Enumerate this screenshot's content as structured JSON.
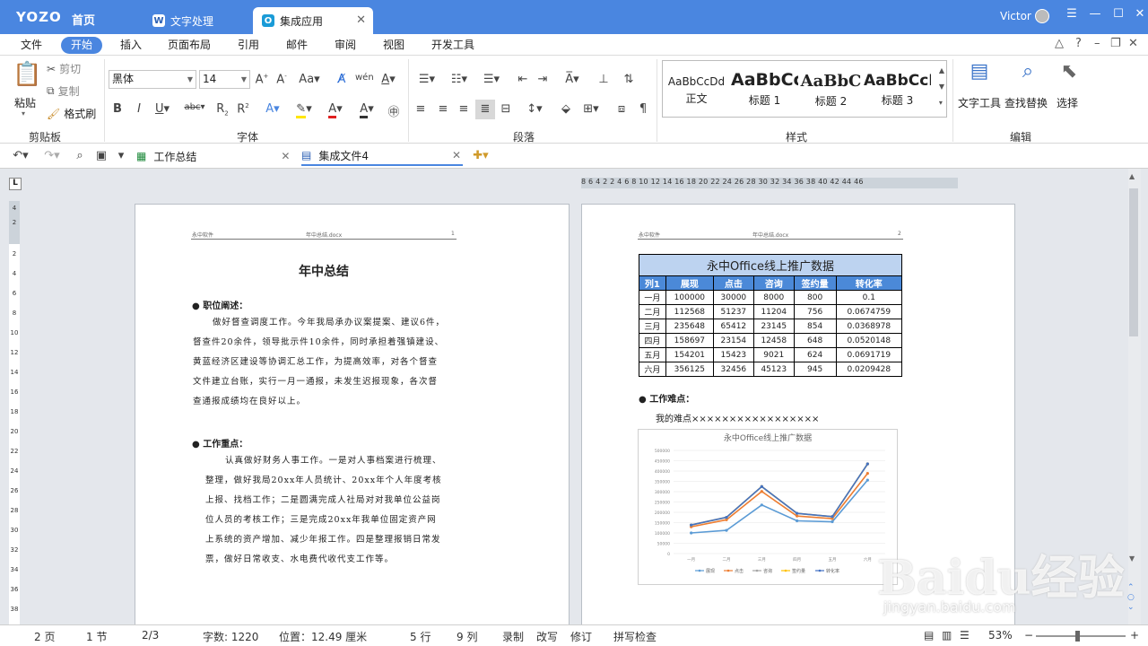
{
  "titlebar": {
    "brand": "YOZO",
    "home": "首页",
    "tabs": [
      {
        "label": "文字处理",
        "icon": "W"
      },
      {
        "label": "集成应用",
        "icon": "O"
      }
    ],
    "user": "Victor"
  },
  "menubar": {
    "items": [
      "文件",
      "开始",
      "插入",
      "页面布局",
      "引用",
      "邮件",
      "审阅",
      "视图",
      "开发工具"
    ],
    "active": "开始"
  },
  "ribbon": {
    "clipboard": {
      "paste": "粘贴",
      "cut": "剪切",
      "copy": "复制",
      "format_painter": "格式刷",
      "label": "剪贴板"
    },
    "font": {
      "name": "黑体",
      "size": "14",
      "label": "字体"
    },
    "paragraph": {
      "label": "段落"
    },
    "styles": {
      "label": "样式",
      "items": [
        {
          "preview": "AaBbCcDd",
          "name": "正文"
        },
        {
          "preview": "AaBbCc",
          "name": "标题 1"
        },
        {
          "preview": "AaBbC",
          "name": "标题 2"
        },
        {
          "preview": "AaBbCcD",
          "name": "标题 3"
        }
      ]
    },
    "editing": {
      "label": "编辑",
      "text_tools": "文字工具",
      "find_replace": "查找替换",
      "select": "选择"
    }
  },
  "doctabs": [
    {
      "label": "工作总结",
      "icon": "excel-icon"
    },
    {
      "label": "集成文件4",
      "icon": "doc-icon"
    }
  ],
  "ruler_h": "8  6  4  2     2  4  6  8  10 12 14 16 18 20 22 24 26 28 30 32 34 36 38  40 42 44 46",
  "page1": {
    "header_left": "永中软件",
    "header_center": "年中总结.docx",
    "header_right": "1",
    "title": "年中总结",
    "section1_heading": "职位阐述：",
    "section1_lines": [
      "做好督查调度工作。今年我局承办议案提案、建议6件，",
      "督查件20余件，领导批示件10余件，同时承担着强镇建设、",
      "黄蓝经济区建设等协调汇总工作，为提高效率，对各个督查",
      "文件建立台账，实行一月一通报，未发生迟报现象，各次督",
      "查通报成绩均在良好以上。"
    ],
    "section2_heading": "工作重点：",
    "section2_lines": [
      "认真做好财务人事工作。一是对人事档案进行梳理、",
      "整理，做好我局20xx年人员统计、20xx年个人年度考核",
      "上报、找档工作；二是圆满完成人社局对对我单位公益岗",
      "位人员的考核工作；三是完成20xx年我单位固定资产网",
      "上系统的资产增加、减少年报工作。四是整理报销日常发",
      "票，做好日常收支、水电费代收代支工作等。"
    ]
  },
  "page2": {
    "header_left": "永中软件",
    "header_center": "年中总结.docx",
    "header_right": "2",
    "table": {
      "title": "永中Office线上推广数据",
      "headers": [
        "列1",
        "展现",
        "点击",
        "咨询",
        "签约量",
        "转化率"
      ],
      "rows": [
        [
          "一月",
          "100000",
          "30000",
          "8000",
          "800",
          "0.1"
        ],
        [
          "二月",
          "112568",
          "51237",
          "11204",
          "756",
          "0.0674759"
        ],
        [
          "三月",
          "235648",
          "65412",
          "23145",
          "854",
          "0.0368978"
        ],
        [
          "四月",
          "158697",
          "23154",
          "12458",
          "648",
          "0.0520148"
        ],
        [
          "五月",
          "154201",
          "15423",
          "9021",
          "624",
          "0.0691719"
        ],
        [
          "六月",
          "356125",
          "32456",
          "45123",
          "945",
          "0.0209428"
        ]
      ]
    },
    "difficulty_heading": "工作难点：",
    "difficulty_text": "我的难点×××××××××××××××××",
    "chart_title": "永中Office线上推广数据"
  },
  "chart_data": {
    "type": "line",
    "title": "永中Office线上推广数据",
    "categories": [
      "一月",
      "二月",
      "三月",
      "四月",
      "五月",
      "六月"
    ],
    "ylim": [
      0,
      500000
    ],
    "yticks": [
      "500000",
      "450000",
      "400000",
      "350000",
      "300000",
      "250000",
      "200000",
      "150000",
      "100000",
      "50000",
      "0"
    ],
    "stacked": true,
    "series": [
      {
        "name": "展现",
        "color": "#5b9bd5",
        "values": [
          100000,
          112568,
          235648,
          158697,
          154201,
          356125
        ]
      },
      {
        "name": "点击",
        "color": "#ed7d31",
        "values": [
          30000,
          51237,
          65412,
          23154,
          15423,
          32456
        ]
      },
      {
        "name": "咨询",
        "color": "#a5a5a5",
        "values": [
          8000,
          11204,
          23145,
          12458,
          9021,
          45123
        ]
      },
      {
        "name": "签约量",
        "color": "#ffc000",
        "values": [
          800,
          756,
          854,
          648,
          624,
          945
        ]
      },
      {
        "name": "转化率",
        "color": "#4472c4",
        "values": [
          0.1,
          0.0674759,
          0.0368978,
          0.0520148,
          0.0691719,
          0.0209428
        ]
      }
    ],
    "legend_position": "bottom"
  },
  "status": {
    "pages": "2 页",
    "section": "1 节",
    "page_of": "2/3",
    "word_count": "字数: 1220",
    "position": "位置：12.49 厘米",
    "line": "5 行",
    "column": "9 列",
    "record": "录制",
    "overwrite": "改写",
    "revise": "修订",
    "spellcheck": "拼写检查",
    "zoom": "53%"
  },
  "watermark": {
    "text": "Baidu经验",
    "url": "jingyan.baidu.com"
  }
}
